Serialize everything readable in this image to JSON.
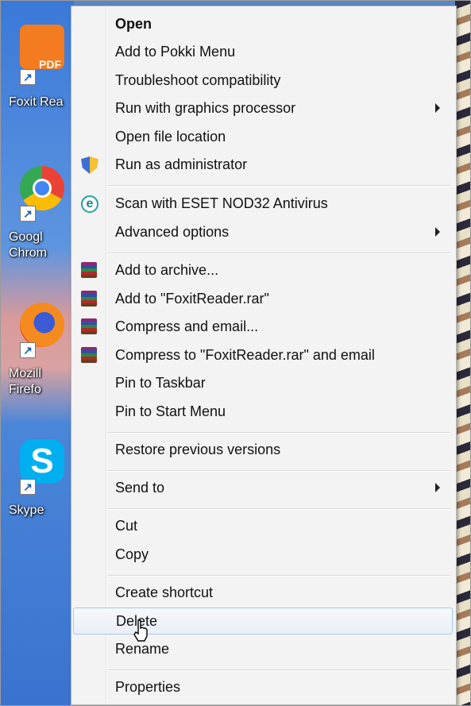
{
  "desktop": {
    "icons": [
      {
        "label": "Foxit Rea",
        "icon": "foxit-pdf-icon",
        "color": "#f47b20"
      },
      {
        "label": "Googl Chrom",
        "icon": "chrome-icon",
        "color": "#34a853"
      },
      {
        "label": "Mozill Firefo",
        "icon": "firefox-icon",
        "color": "#e66000"
      },
      {
        "label": "Skype",
        "icon": "skype-icon",
        "color": "#00aff0"
      }
    ]
  },
  "menu": {
    "items": [
      {
        "label": "Open",
        "bold": true
      },
      {
        "label": "Add to Pokki Menu"
      },
      {
        "label": "Troubleshoot compatibility"
      },
      {
        "label": "Run with graphics processor",
        "submenu": true
      },
      {
        "label": "Open file location"
      },
      {
        "label": "Run as administrator",
        "icon": "uac-shield-icon"
      },
      {
        "label": "Scan with ESET NOD32 Antivirus",
        "icon": "eset-icon"
      },
      {
        "label": "Advanced options",
        "submenu": true
      },
      {
        "label": "Add to archive...",
        "icon": "winrar-icon"
      },
      {
        "label": "Add to \"FoxitReader.rar\"",
        "icon": "winrar-icon"
      },
      {
        "label": "Compress and email...",
        "icon": "winrar-icon"
      },
      {
        "label": "Compress to \"FoxitReader.rar\" and email",
        "icon": "winrar-icon"
      },
      {
        "label": "Pin to Taskbar"
      },
      {
        "label": "Pin to Start Menu"
      },
      {
        "label": "Restore previous versions"
      },
      {
        "label": "Send to",
        "submenu": true
      },
      {
        "label": "Cut"
      },
      {
        "label": "Copy"
      },
      {
        "label": "Create shortcut"
      },
      {
        "label": "Delete",
        "hovered": true
      },
      {
        "label": "Rename"
      },
      {
        "label": "Properties"
      }
    ]
  },
  "colors": {
    "menu_bg": "#f3f3f3",
    "hover_border": "#aec6e6"
  }
}
